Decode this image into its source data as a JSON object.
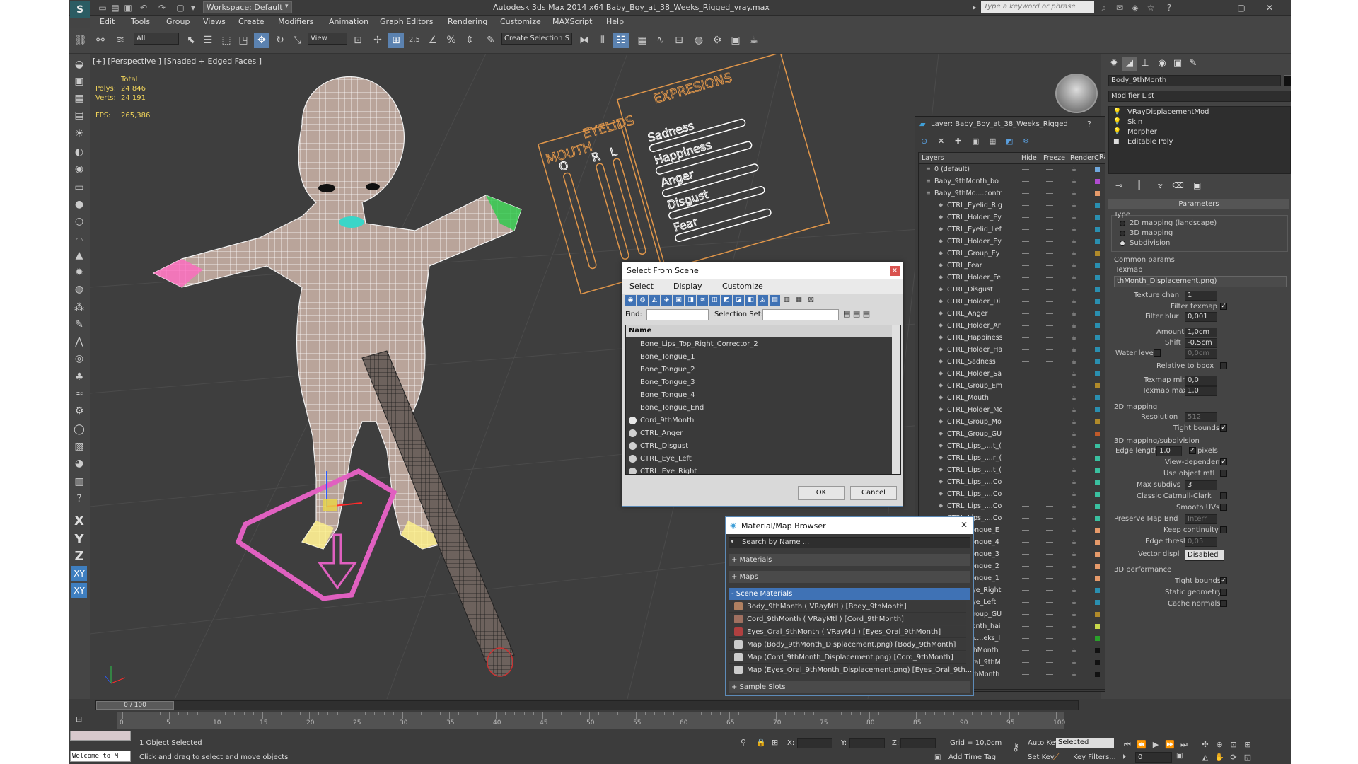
{
  "app": {
    "title": "Autodesk 3ds Max  2014 x64     Baby_Boy_at_38_Weeks_Rigged_vray.max",
    "workspace": "Workspace: Default",
    "keyword_placeholder": "Type a keyword or phrase",
    "logo": "S"
  },
  "menu": [
    "Edit",
    "Tools",
    "Group",
    "Views",
    "Create",
    "Modifiers",
    "Animation",
    "Graph Editors",
    "Rendering",
    "Customize",
    "MAXScript",
    "Help"
  ],
  "toolbar": {
    "filter": "All",
    "ref_coord": "View",
    "selection_set": "Create Selection S",
    "snap_label": "2.5",
    "percent_label": "%"
  },
  "viewport": {
    "label": "[+] [Perspective ] [Shaded + Edged Faces ]",
    "stats_total": "Total",
    "polys_label": "Polys:",
    "polys_value": "24 846",
    "verts_label": "Verts:",
    "verts_value": "24 191",
    "fps_label": "FPS:",
    "fps_value": "265,386",
    "controls": {
      "mouth": "MOUTH",
      "eyelids": "EYELIDS",
      "expressions": "EXPRESIONS",
      "mouth_o": "O",
      "eye_r": "R",
      "eye_l": "L",
      "exprs": [
        "Sadness",
        "Happiness",
        "Anger",
        "Disgust",
        "Fear"
      ]
    }
  },
  "left_toolbar": {
    "x": "X",
    "y": "Y",
    "z": "Z",
    "xy": "XY",
    "xy2": "XY"
  },
  "command_panel": {
    "object_name": "Body_9thMonth",
    "modifier_list": "Modifier List",
    "stack": [
      "VRayDisplacementMod",
      "Skin",
      "Morpher",
      "Editable Poly"
    ],
    "rollout_parameters": "Parameters",
    "type_label": "Type",
    "type_options": [
      "2D mapping (landscape)",
      "3D mapping",
      "Subdivision"
    ],
    "common_params": "Common params",
    "texmap_label": "Texmap",
    "texmap_value": "thMonth_Displacement.png)",
    "texture_chan_label": "Texture chan",
    "texture_chan_value": "1",
    "filter_texmap": "Filter texmap",
    "filter_blur_label": "Filter blur",
    "filter_blur_value": "0,001",
    "amount_label": "Amount",
    "amount_value": "1,0cm",
    "shift_label": "Shift",
    "shift_value": "-0,5cm",
    "water_level_label": "Water level",
    "water_level_value": "0,0cm",
    "relative_bbox": "Relative to bbox",
    "texmap_min_label": "Texmap min",
    "texmap_min_value": "0,0",
    "texmap_max_label": "Texmap max",
    "texmap_max_value": "1,0",
    "mapping2d": "2D mapping",
    "resolution_label": "Resolution",
    "resolution_value": "512",
    "tight_bounds": "Tight bounds",
    "mapping3d": "3D mapping/subdivision",
    "edge_length_label": "Edge length",
    "edge_length_value": "1,0",
    "pixels": "pixels",
    "view_dependent": "View-dependent",
    "use_object_mtl": "Use object mtl",
    "max_subdivs_label": "Max subdivs",
    "max_subdivs_value": "3",
    "classic_cc": "Classic Catmull-Clark",
    "smooth_uvs": "Smooth UVs",
    "preserve_map_label": "Preserve Map Bnd",
    "preserve_map_value": "Interr",
    "keep_continuity": "Keep continuity",
    "edge_thresh_label": "Edge thresh",
    "edge_thresh_value": "0,05",
    "vector_displ_label": "Vector displ",
    "vector_displ_value": "Disabled",
    "perf": "3D performance",
    "tight_bounds2": "Tight bounds",
    "static_geometry": "Static geometry",
    "cache_normals": "Cache normals"
  },
  "layer_dialog": {
    "title": "Layer: Baby_Boy_at_38_Weeks_Rigged",
    "help": "?",
    "close": "✕",
    "cols": {
      "layers": "Layers",
      "hide": "Hide",
      "freeze": "Freeze",
      "render": "Render",
      "color": "C...",
      "radiosity": "Radiosity"
    },
    "rows": [
      {
        "name": "0 (default)",
        "indent": 0,
        "color": "#6fa8dc"
      },
      {
        "name": "Baby_9thMonth_bo",
        "indent": 0,
        "color": "#b04bd0"
      },
      {
        "name": "Baby_9thMo....contr",
        "indent": 0,
        "color": "#e69a6a"
      },
      {
        "name": "CTRL_Eyelid_Rig",
        "indent": 1,
        "color": "#2a8fb0"
      },
      {
        "name": "CTRL_Holder_Ey",
        "indent": 1,
        "color": "#2a8fb0"
      },
      {
        "name": "CTRL_Eyelid_Lef",
        "indent": 1,
        "color": "#2a8fb0"
      },
      {
        "name": "CTRL_Holder_Ey",
        "indent": 1,
        "color": "#2a8fb0"
      },
      {
        "name": "CTRL_Group_Ey",
        "indent": 1,
        "color": "#b08a2a"
      },
      {
        "name": "CTRL_Fear",
        "indent": 1,
        "color": "#2a8fb0"
      },
      {
        "name": "CTRL_Holder_Fe",
        "indent": 1,
        "color": "#2a8fb0"
      },
      {
        "name": "CTRL_Disgust",
        "indent": 1,
        "color": "#2a8fb0"
      },
      {
        "name": "CTRL_Holder_Di",
        "indent": 1,
        "color": "#2a8fb0"
      },
      {
        "name": "CTRL_Anger",
        "indent": 1,
        "color": "#2a8fb0"
      },
      {
        "name": "CTRL_Holder_Ar",
        "indent": 1,
        "color": "#2a8fb0"
      },
      {
        "name": "CTRL_Happiness",
        "indent": 1,
        "color": "#2a8fb0"
      },
      {
        "name": "CTRL_Holder_Ha",
        "indent": 1,
        "color": "#2a8fb0"
      },
      {
        "name": "CTRL_Sadness",
        "indent": 1,
        "color": "#2a8fb0"
      },
      {
        "name": "CTRL_Holder_Sa",
        "indent": 1,
        "color": "#2a8fb0"
      },
      {
        "name": "CTRL_Group_Em",
        "indent": 1,
        "color": "#b08a2a"
      },
      {
        "name": "CTRL_Mouth",
        "indent": 1,
        "color": "#2a8fb0"
      },
      {
        "name": "CTRL_Holder_Mc",
        "indent": 1,
        "color": "#2a8fb0"
      },
      {
        "name": "CTRL_Group_Mo",
        "indent": 1,
        "color": "#b08a2a"
      },
      {
        "name": "CTRL_Group_GU",
        "indent": 1,
        "color": "#c05a2a"
      },
      {
        "name": "CTRL_Lips_....t_(",
        "indent": 1,
        "color": "#3ac0a0"
      },
      {
        "name": "CTRL_Lips_....r_(",
        "indent": 1,
        "color": "#3ac0a0"
      },
      {
        "name": "CTRL_Lips_....t_(",
        "indent": 1,
        "color": "#3ac0a0"
      },
      {
        "name": "CTRL_Lips_....Co",
        "indent": 1,
        "color": "#3ac0a0"
      },
      {
        "name": "CTRL_Lips_....Co",
        "indent": 1,
        "color": "#3ac0a0"
      },
      {
        "name": "CTRL_Lips_....Co",
        "indent": 1,
        "color": "#3ac0a0"
      },
      {
        "name": "CTRL_Lips_....Co",
        "indent": 1,
        "color": "#3ac0a0"
      },
      {
        "name": "CTRL_Tongue_E",
        "indent": 1,
        "color": "#e69a6a"
      },
      {
        "name": "CTRL_Tongue_4",
        "indent": 1,
        "color": "#e69a6a"
      },
      {
        "name": "CTRL_Tongue_3",
        "indent": 1,
        "color": "#e69a6a"
      },
      {
        "name": "CTRL_Tongue_2",
        "indent": 1,
        "color": "#e69a6a"
      },
      {
        "name": "CTRL_Tongue_1",
        "indent": 1,
        "color": "#e69a6a"
      },
      {
        "name": "CTRL_Eye_Right",
        "indent": 1,
        "color": "#2a8fb0"
      },
      {
        "name": "CTRL_Eye_Left",
        "indent": 1,
        "color": "#2a8fb0"
      },
      {
        "name": "CTRL_Group_GU",
        "indent": 1,
        "color": "#b08a2a"
      },
      {
        "name": "Baby_9thMonth_hai",
        "indent": 0,
        "color": "#c8d84a"
      },
      {
        "name": "Baby_Boy_a....eks_I",
        "indent": 0,
        "color": "#2aa02a"
      },
      {
        "name": "Cord_9thMonth",
        "indent": 1,
        "color": "#111111"
      },
      {
        "name": "Eyes_Oral_9thM",
        "indent": 1,
        "color": "#111111"
      },
      {
        "name": "Body_9thMonth",
        "indent": 1,
        "color": "#111111"
      }
    ]
  },
  "select_dialog": {
    "title": "Select From Scene",
    "close": "✕",
    "menus": [
      "Select",
      "Display",
      "Customize"
    ],
    "find_label": "Find:",
    "selset_label": "Selection Set:",
    "name_header": "Name",
    "rows": [
      {
        "name": "Bone_Lips_Top_Right_Corrector_2",
        "icon": "bone"
      },
      {
        "name": "Bone_Tongue_1",
        "icon": "bone"
      },
      {
        "name": "Bone_Tongue_2",
        "icon": "bone"
      },
      {
        "name": "Bone_Tongue_3",
        "icon": "bone"
      },
      {
        "name": "Bone_Tongue_4",
        "icon": "bone"
      },
      {
        "name": "Bone_Tongue_End",
        "icon": "bone"
      },
      {
        "name": "Cord_9thMonth",
        "icon": "geo"
      },
      {
        "name": "CTRL_Anger",
        "icon": "shape"
      },
      {
        "name": "CTRL_Disgust",
        "icon": "shape"
      },
      {
        "name": "CTRL_Eye_Left",
        "icon": "shape"
      },
      {
        "name": "CTRL_Eye_Right",
        "icon": "shape"
      }
    ],
    "ok": "OK",
    "cancel": "Cancel"
  },
  "material_browser": {
    "title": "Material/Map Browser",
    "close": "✕",
    "search_placeholder": "Search by Name ...",
    "sections": {
      "materials": "+ Materials",
      "maps": "+ Maps",
      "scene": "- Scene Materials",
      "samples": "+ Sample Slots"
    },
    "items": [
      {
        "name": "Body_9thMonth  ( VRayMtl ) [Body_9thMonth]",
        "swatch": "#b08060"
      },
      {
        "name": "Cord_9thMonth  ( VRayMtl ) [Cord_9thMonth]",
        "swatch": "#a07060"
      },
      {
        "name": "Eyes_Oral_9thMonth  ( VRayMtl ) [Eyes_Oral_9thMonth]",
        "swatch": "#b04040"
      },
      {
        "name": "Map (Body_9thMonth_Displacement.png) [Body_9thMonth]",
        "swatch": "#cccccc"
      },
      {
        "name": "Map (Cord_9thMonth_Displacement.png) [Cord_9thMonth]",
        "swatch": "#cccccc"
      },
      {
        "name": "Map (Eyes_Oral_9thMonth_Displacement.png) [Eyes_Oral_9th...",
        "swatch": "#cccccc"
      }
    ]
  },
  "timeline": {
    "frame": "0 / 100",
    "ticks": [
      0,
      5,
      10,
      15,
      20,
      25,
      30,
      35,
      40,
      45,
      50,
      55,
      60,
      65,
      70,
      75,
      80,
      85,
      90,
      95,
      100
    ]
  },
  "status": {
    "maxscript": "Welcome to M",
    "selected": "1 Object Selected",
    "prompt": "Click and drag to select and move objects",
    "x_label": "X:",
    "y_label": "Y:",
    "z_label": "Z:",
    "grid": "Grid = 10,0cm",
    "add_time_tag": "Add Time Tag",
    "auto_key": "Auto Key",
    "selected_combo": "Selected",
    "set_key": "Set Key",
    "key_filters": "Key Filters...",
    "frame_value": "0"
  },
  "colors": {
    "accent": "#5b82b0",
    "viewport_bg": "#3e3e3e",
    "wire": "#ffffff",
    "skin_tint": "#c9b0a0",
    "control_orange": "#e0964a",
    "pink": "#e060c0"
  }
}
